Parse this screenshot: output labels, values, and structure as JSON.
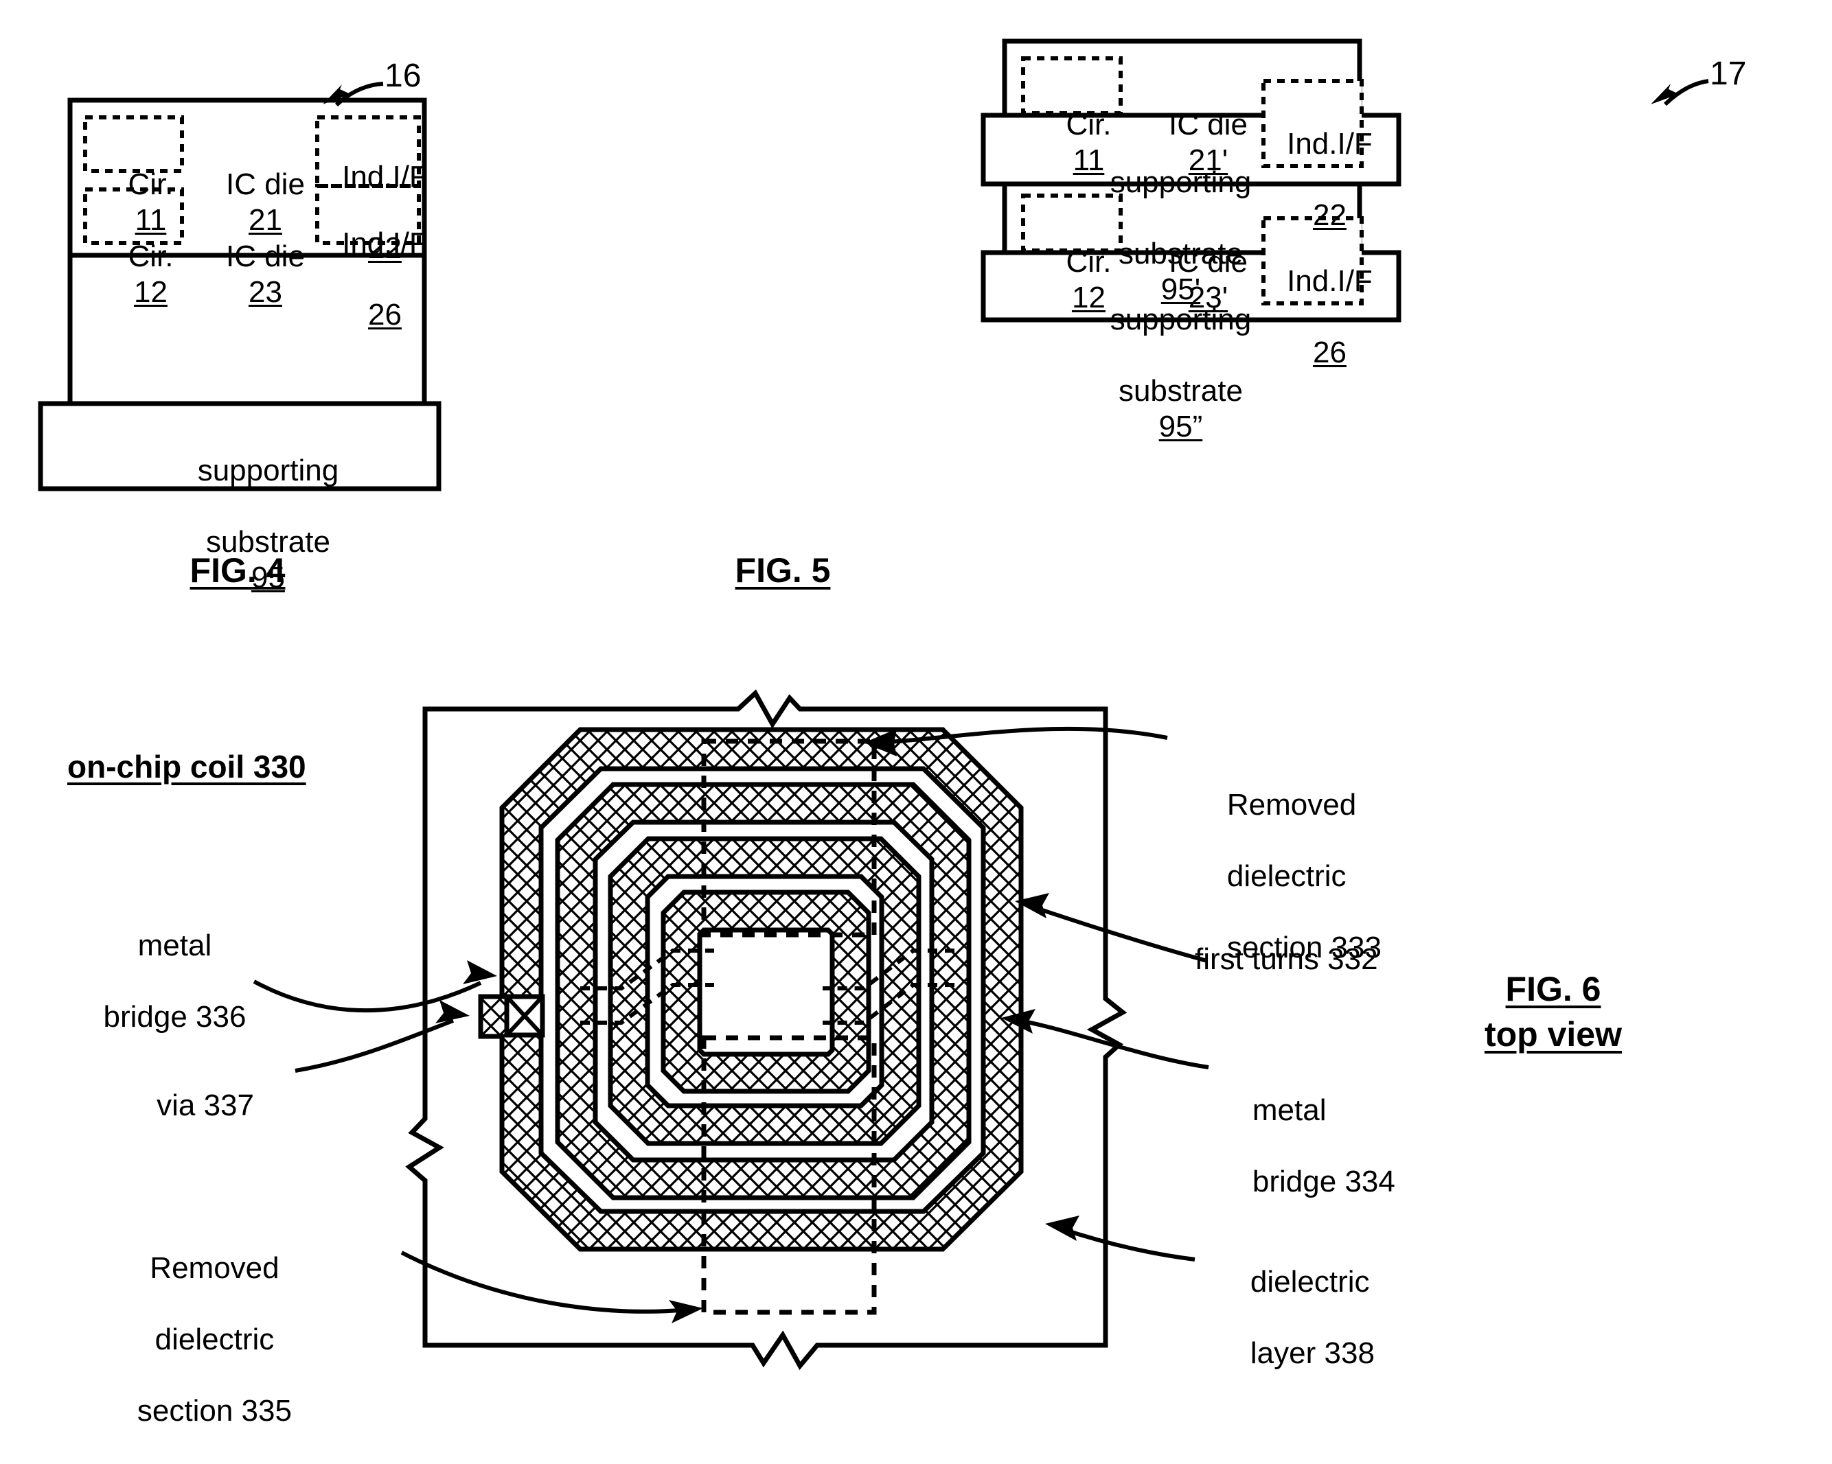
{
  "figures": [
    {
      "id": "fig4",
      "caption": "FIG. 4",
      "ref_numeral": "16",
      "blocks": {
        "cir_top": "Cir. 11",
        "cir_top_label": "Cir.",
        "cir_top_num": "11",
        "die_top": "IC die 21",
        "die_top_label": "IC die",
        "die_top_num": "21",
        "indif_top_label": "Ind.I/F",
        "indif_top_num": "22",
        "cir_bot_label": "Cir.",
        "cir_bot_num": "12",
        "die_bot_label": "IC die",
        "die_bot_num": "23",
        "indif_bot_label": "Ind.I/F",
        "indif_bot_num": "26",
        "substrate_line1": "supporting",
        "substrate_line2": "substrate",
        "substrate_num": "95"
      }
    },
    {
      "id": "fig5",
      "caption": "FIG. 5",
      "ref_numeral": "17",
      "blocks": {
        "cir_top_label": "Cir.",
        "cir_top_num": "11",
        "die_top_label": "IC die",
        "die_top_num": "21'",
        "indif_top_label": "Ind.I/F",
        "indif_top_num": "22",
        "substrate_top_line1": "supporting",
        "substrate_top_line2": "substrate",
        "substrate_top_num": "95'",
        "cir_bot_label": "Cir.",
        "cir_bot_num": "12",
        "die_bot_label": "IC die",
        "die_bot_num": "23'",
        "indif_bot_label": "Ind.I/F",
        "indif_bot_num": "26",
        "substrate_bot_line1": "supporting",
        "substrate_bot_line2": "substrate",
        "substrate_bot_num": "95”"
      }
    },
    {
      "id": "fig6",
      "caption_line1": "FIG. 6",
      "caption_line2": "top view",
      "title": "on-chip coil 330",
      "labels": {
        "removed_dielectric_333": [
          "Removed",
          "dielectric",
          "section 333"
        ],
        "first_turns_332": "first turns 332",
        "metal_bridge_334": [
          "metal",
          "bridge 334"
        ],
        "dielectric_layer_338": [
          "dielectric",
          "layer 338"
        ],
        "metal_bridge_336": [
          "metal",
          "bridge 336"
        ],
        "via_337": "via 337",
        "removed_dielectric_335": [
          "Removed",
          "dielectric",
          "section 335"
        ]
      }
    }
  ],
  "colors": {
    "line": "#000000",
    "background": "#ffffff",
    "hatch": "#000000"
  }
}
